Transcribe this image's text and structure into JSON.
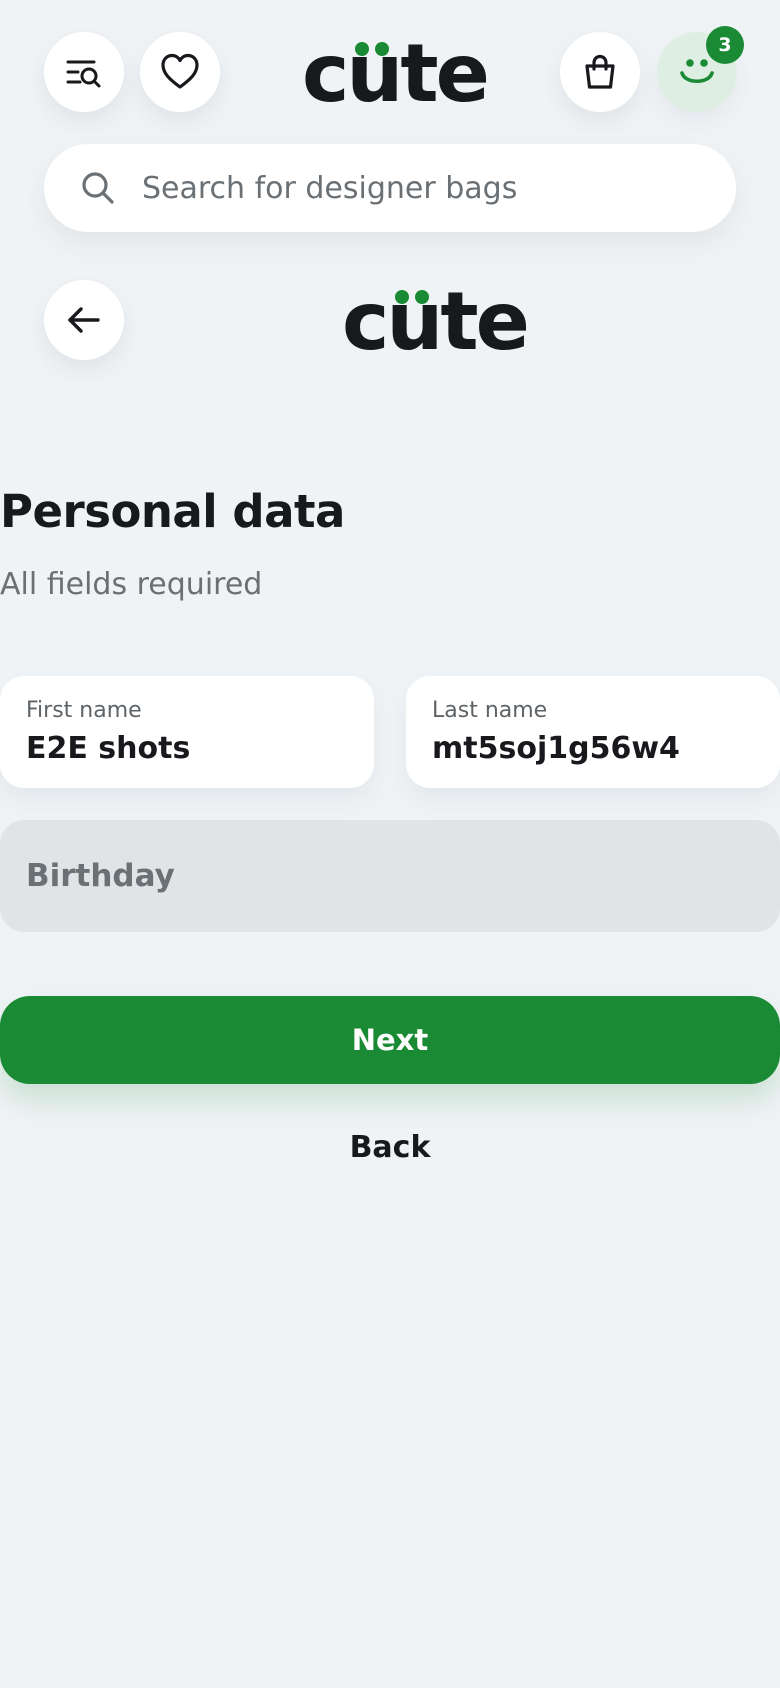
{
  "header": {
    "logo_text": "cute",
    "search_placeholder": "Search for designer bags",
    "account_badge_count": "3",
    "icons": [
      "menu-search-icon",
      "heart-icon",
      "shopping-bag-icon",
      "smiley-account-icon",
      "search-icon",
      "arrow-left-icon"
    ]
  },
  "brand": {
    "logo_text": "cute",
    "accent_color": "#1a8b34"
  },
  "form": {
    "title": "Personal data",
    "subtitle": "All fields required",
    "first_name_label": "First name",
    "first_name_value": "E2E shots",
    "last_name_label": "Last name",
    "last_name_value": "mt5soj1g56w4",
    "birthday_placeholder": "Birthday",
    "next_label": "Next",
    "back_label": "Back"
  }
}
